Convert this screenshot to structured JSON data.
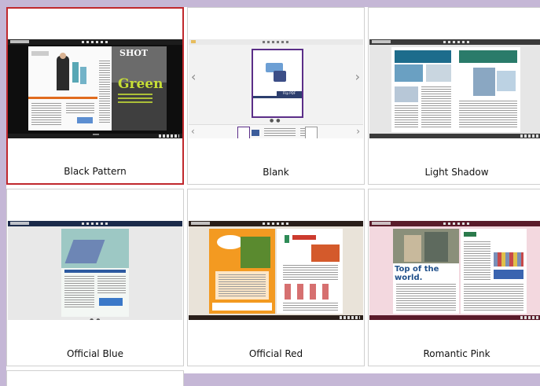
{
  "themes": [
    {
      "name": "Black Pattern",
      "selected": true,
      "toolbar_color": "#1c1c1c",
      "background_color": "#0d0d0d",
      "cover_headline": "Green",
      "cover_subhead": "SHOT"
    },
    {
      "name": "Blank",
      "selected": false,
      "toolbar_color": "#eeeeee",
      "background_color": "#f0f0f0",
      "cover_button": "Flip PDF"
    },
    {
      "name": "Light Shadow",
      "selected": false,
      "toolbar_color": "#3a3a3a",
      "background_color": "#e6e6e6"
    },
    {
      "name": "Official Blue",
      "selected": false,
      "toolbar_color": "#1b2a4a",
      "background_color": "#e8e8e8"
    },
    {
      "name": "Official Red",
      "selected": false,
      "toolbar_color": "#2a1f1a",
      "background_color": "#e9e3d9"
    },
    {
      "name": "Romantic Pink",
      "selected": false,
      "toolbar_color": "#5a1b2a",
      "background_color": "#f3d8df",
      "cover_headline": "Top of the world."
    }
  ]
}
